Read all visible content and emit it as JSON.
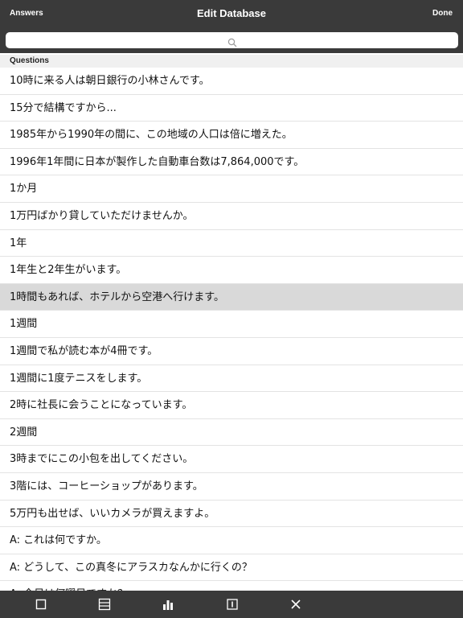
{
  "navbar": {
    "left_label": "Answers",
    "title": "Edit Database",
    "right_label": "Done"
  },
  "search": {
    "value": "",
    "icon": "search-icon"
  },
  "section": {
    "header": "Questions"
  },
  "questions": {
    "selected_index": 8,
    "items": [
      "10時に来る人は朝日銀行の小林さんです。",
      "15分で結構ですから...",
      "1985年から1990年の間に、この地域の人口は倍に増えた。",
      "1996年1年間に日本が製作した自動車台数は7,864,000です。",
      "1か月",
      "1万円ばかり貸していただけませんか。",
      "1年",
      "1年生と2年生がいます。",
      "1時間もあれば、ホテルから空港へ行けます。",
      "1週間",
      "1週間で私が読む本が4冊です。",
      "1週間に1度テニスをします。",
      "2時に社長に会うことになっています。",
      "2週間",
      "3時までにこの小包を出してください。",
      "3階には、コーヒーショップがあります。",
      "5万円も出せば、いいカメラが買えますよ。",
      "A: これは何ですか。",
      "A: どうして、この真冬にアラスカなんかに行くの？",
      "A: 今日は何曜日ですか？"
    ]
  },
  "toolbar": {
    "icons": [
      "square-icon",
      "list-icon",
      "bar-chart-icon",
      "info-icon",
      "close-icon"
    ]
  },
  "colors": {
    "bar_background": "#3a3a3a",
    "selected_row": "#d9d9d9",
    "section_header": "#f0f0f0"
  }
}
